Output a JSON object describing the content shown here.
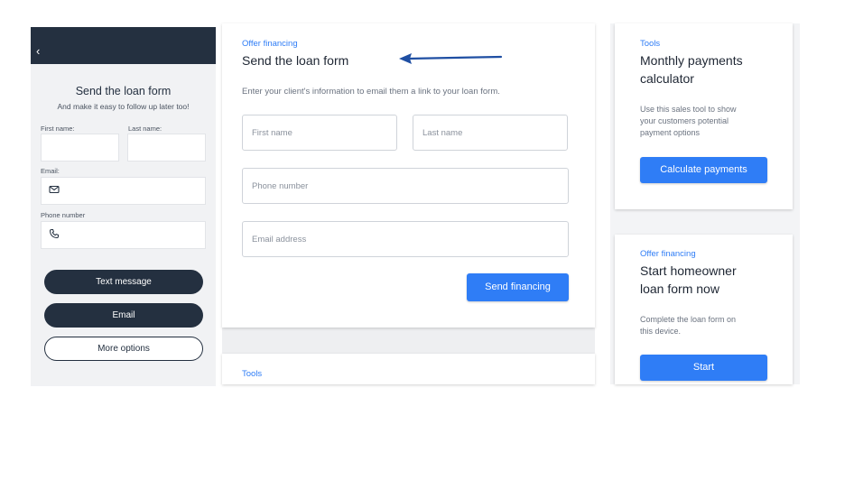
{
  "mobile": {
    "back_icon": "chevron-left-icon",
    "back_glyph": "‹",
    "title": "Send the loan form",
    "subtitle": "And make it easy to follow up later too!",
    "first_name_label": "First name:",
    "last_name_label": "Last name:",
    "email_label": "Email:",
    "email_icon": "mail-icon",
    "phone_label": "Phone number",
    "phone_icon": "phone-icon",
    "text_message_button": "Text message",
    "email_button": "Email",
    "more_options_button": "More options"
  },
  "send_form_card": {
    "eyebrow": "Offer financing",
    "title": "Send the loan form",
    "hint": "Enter your client's information to email them a link to your loan form.",
    "first_name_placeholder": "First name",
    "last_name_placeholder": "Last name",
    "phone_placeholder": "Phone number",
    "email_placeholder": "Email address",
    "submit_button": "Send financing",
    "annotation_arrow_color": "#1f4fa3"
  },
  "tools_card_bottom": {
    "eyebrow": "Tools"
  },
  "monthly_card": {
    "eyebrow": "Tools",
    "title_line1": "Monthly payments",
    "title_line2": "calculator",
    "body_line1": "Use this sales tool to show",
    "body_line2": "your customers potential",
    "body_line3": "payment options",
    "button": "Calculate payments"
  },
  "homeowner_card": {
    "eyebrow": "Offer financing",
    "title_line1": "Start homeowner",
    "title_line2": "loan form now",
    "body_line1": "Complete the loan form on",
    "body_line2": "this device.",
    "button": "Start"
  },
  "colors": {
    "accent": "#2f7df6",
    "dark_navy": "#243040"
  }
}
